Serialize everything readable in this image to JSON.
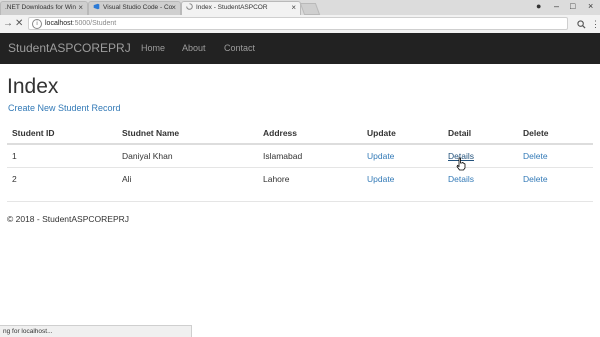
{
  "browser": {
    "tabs": [
      {
        "title": ".NET Downloads for Win",
        "active": false
      },
      {
        "title": "Visual Studio Code - Co",
        "active": false
      },
      {
        "title": "Index - StudentASPCOR",
        "active": true
      }
    ],
    "url": {
      "host": "localhost",
      "path": ":5000/Student"
    },
    "status_text": "ng for localhost..."
  },
  "navbar": {
    "brand": "StudentASPCOREPRJ",
    "links": [
      "Home",
      "About",
      "Contact"
    ]
  },
  "page": {
    "title": "Index",
    "create_link": "Create New Student Record"
  },
  "table": {
    "headers": [
      "Student ID",
      "Studnet Name",
      "Address",
      "Update",
      "Detail",
      "Delete"
    ],
    "rows": [
      {
        "id": "1",
        "name": "Daniyal Khan",
        "address": "Islamabad",
        "update": "Update",
        "detail": "Details",
        "delete": "Delete"
      },
      {
        "id": "2",
        "name": "Ali",
        "address": "Lahore",
        "update": "Update",
        "detail": "Details",
        "delete": "Delete"
      }
    ]
  },
  "footer": {
    "text": "© 2018 - StudentASPCOREPRJ"
  },
  "colors": {
    "navbar_bg": "#222222",
    "link": "#337ab7",
    "nav_text": "#9d9d9d"
  }
}
